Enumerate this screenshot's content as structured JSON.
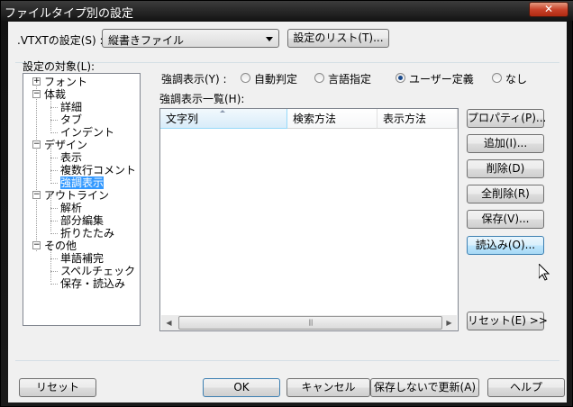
{
  "window": {
    "title": "ファイルタイプ別の設定",
    "close_glyph": "✕"
  },
  "vtxt": {
    "label": ".VTXTの設定(S) :",
    "selected": "縦書きファイル",
    "list_button": "設定のリスト(T)..."
  },
  "target": {
    "label": "設定の対象(L):"
  },
  "tree": [
    {
      "label": "フォント",
      "expander": "+"
    },
    {
      "label": "体裁",
      "expander": "−"
    },
    {
      "label": "詳細"
    },
    {
      "label": "タブ"
    },
    {
      "label": "インデント"
    },
    {
      "label": "デザイン",
      "expander": "−"
    },
    {
      "label": "表示"
    },
    {
      "label": "複数行コメント"
    },
    {
      "label": "強調表示",
      "selected": true
    },
    {
      "label": "アウトライン",
      "expander": "−"
    },
    {
      "label": "解析"
    },
    {
      "label": "部分編集"
    },
    {
      "label": "折りたたみ"
    },
    {
      "label": "その他",
      "expander": "−"
    },
    {
      "label": "単語補完"
    },
    {
      "label": "スペルチェック"
    },
    {
      "label": "保存・読込み"
    }
  ],
  "highlight": {
    "label": "強調表示(Y) :",
    "options": [
      "自動判定",
      "言語指定",
      "ユーザー定義",
      "なし"
    ],
    "selected": "ユーザー定義"
  },
  "list": {
    "label": "強調表示一覧(H):",
    "columns": [
      "文字列",
      "検索方法",
      "表示方法"
    ],
    "scroll_left": "◀",
    "scroll_right": "▶",
    "thumb_grip": "|||"
  },
  "side_buttons": [
    "プロパティ(P)...",
    "追加(I)...",
    "削除(D)",
    "全削除(R)",
    "保存(V)...",
    "読込み(O)..."
  ],
  "reset_list_button": "リセット(E) >>",
  "footer": {
    "reset": "リセット",
    "ok": "OK",
    "cancel": "キャンセル",
    "apply": "保存しないで更新(A)",
    "help": "ヘルプ"
  }
}
